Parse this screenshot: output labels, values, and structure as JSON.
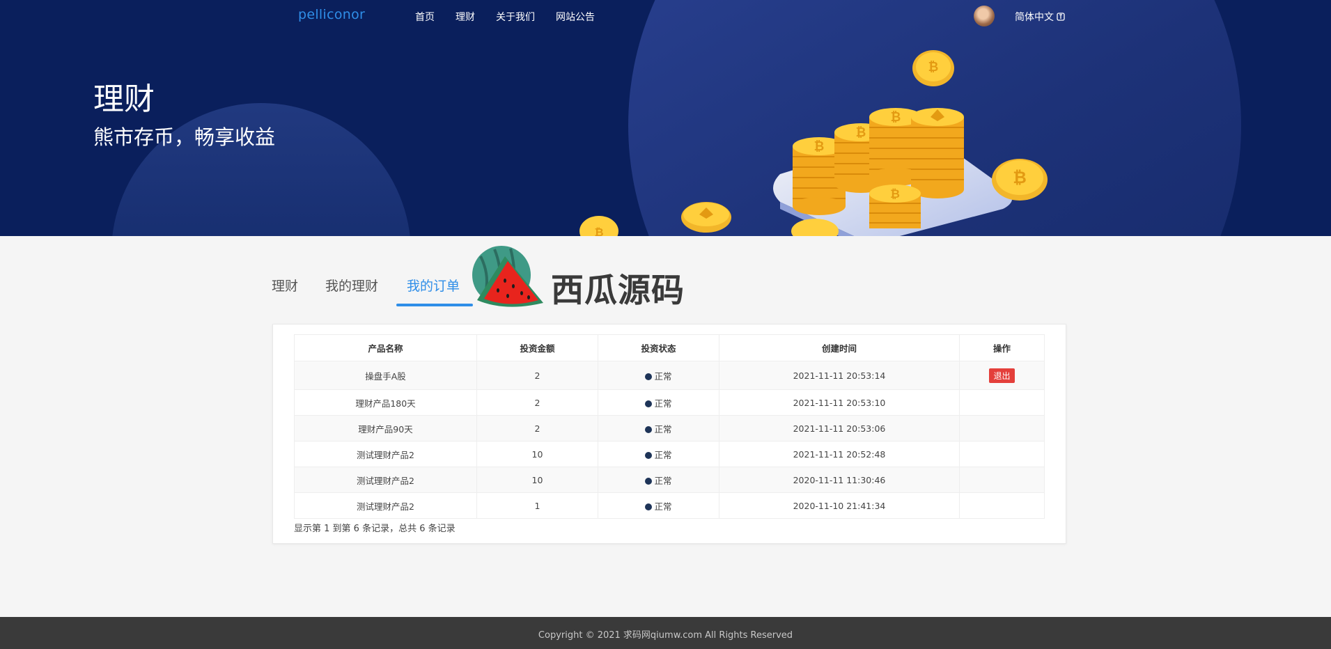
{
  "header": {
    "logo": "pelliconor",
    "nav": [
      "首页",
      "理财",
      "关于我们",
      "网站公告"
    ],
    "language": "简体中文"
  },
  "hero": {
    "title": "理财",
    "subtitle": "熊市存币，畅享收益"
  },
  "tabs": [
    "理财",
    "我的理财",
    "我的订单"
  ],
  "active_tab": "我的订单",
  "watermark": {
    "text": "西瓜源码"
  },
  "orders": {
    "columns": [
      "产品名称",
      "投资金额",
      "投资状态",
      "创建时间",
      "操作"
    ],
    "rows": [
      {
        "name": "操盘手A股",
        "amount": "2",
        "status": "正常",
        "created": "2021-11-11 20:53:14",
        "action": "退出"
      },
      {
        "name": "理财产品180天",
        "amount": "2",
        "status": "正常",
        "created": "2021-11-11 20:53:10",
        "action": ""
      },
      {
        "name": "理财产品90天",
        "amount": "2",
        "status": "正常",
        "created": "2021-11-11 20:53:06",
        "action": ""
      },
      {
        "name": "测试理财产品2",
        "amount": "10",
        "status": "正常",
        "created": "2021-11-11 20:52:48",
        "action": ""
      },
      {
        "name": "测试理财产品2",
        "amount": "10",
        "status": "正常",
        "created": "2020-11-11 11:30:46",
        "action": ""
      },
      {
        "name": "测试理财产品2",
        "amount": "1",
        "status": "正常",
        "created": "2020-11-10 21:41:34",
        "action": ""
      }
    ],
    "summary": "显示第 1 到第 6 条记录，总共 6 条记录"
  },
  "footer": {
    "copyright": "Copyright © 2021 求码网qiumw.com All Rights Reserved"
  },
  "colors": {
    "hero_bg": "#0a1f5c",
    "accent": "#2f8ee8",
    "danger": "#e43f3b",
    "footer_bg": "#3a3a3a",
    "status_dot": "#1e3458"
  },
  "icons": [
    "user-avatar",
    "translate-icon",
    "coin-stack-illustration",
    "watermelon-logo"
  ]
}
